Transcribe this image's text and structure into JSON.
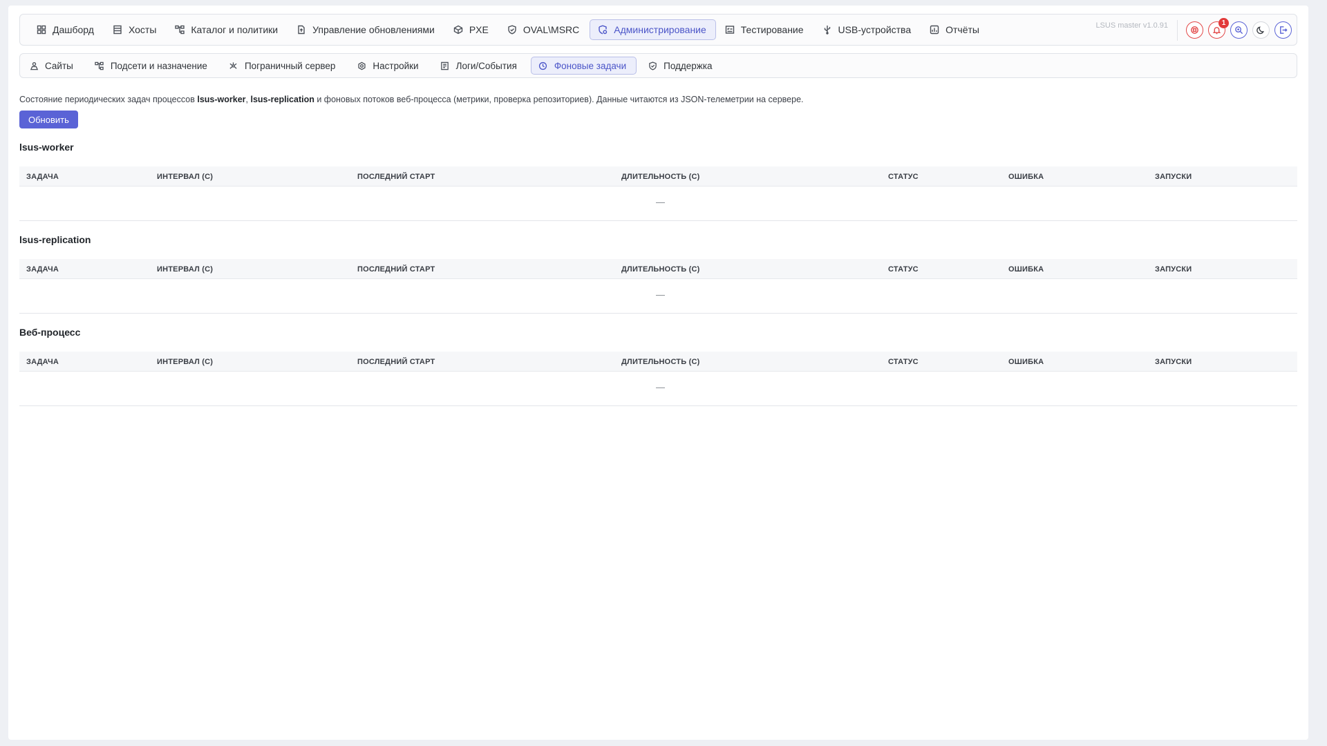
{
  "nav": {
    "items": [
      {
        "label": "Дашборд",
        "icon": "dashboard-icon"
      },
      {
        "label": "Хосты",
        "icon": "server-icon"
      },
      {
        "label": "Каталог и политики",
        "icon": "hierarchy-icon"
      },
      {
        "label": "Управление обновлениями",
        "icon": "file-upload-icon"
      },
      {
        "label": "PXE",
        "icon": "cube-icon"
      },
      {
        "label": "OVAL\\MSRC",
        "icon": "shield-check-icon"
      },
      {
        "label": "Администрирование",
        "icon": "admin-settings-icon",
        "active": true
      },
      {
        "label": "Тестирование",
        "icon": "checklist-icon"
      },
      {
        "label": "USB-устройства",
        "icon": "usb-icon"
      },
      {
        "label": "Отчёты",
        "icon": "report-icon"
      }
    ],
    "version": "LSUS master v1.0.91",
    "notification_count": "1"
  },
  "subnav": {
    "items": [
      {
        "label": "Сайты",
        "icon": "sites-icon"
      },
      {
        "label": "Подсети и назначение",
        "icon": "subnet-icon"
      },
      {
        "label": "Пограничный сервер",
        "icon": "network-hub-icon"
      },
      {
        "label": "Настройки",
        "icon": "gear-icon"
      },
      {
        "label": "Логи/События",
        "icon": "log-icon"
      },
      {
        "label": "Фоновые задачи",
        "icon": "clock-icon",
        "active": true
      },
      {
        "label": "Поддержка",
        "icon": "shield-icon"
      }
    ]
  },
  "description": {
    "prefix": "Состояние периодических задач процессов ",
    "worker": "lsus-worker",
    "comma": ", ",
    "replication": "lsus-replication",
    "suffix": " и фоновых потоков веб-процесса (метрики, проверка репозиториев). Данные читаются из JSON-телеметрии на сервере."
  },
  "refresh_label": "Обновить",
  "columns": [
    "ЗАДАЧА",
    "ИНТЕРВАЛ (С)",
    "ПОСЛЕДНИЙ СТАРТ",
    "ДЛИТЕЛЬНОСТЬ (С)",
    "СТАТУС",
    "ОШИБКА",
    "ЗАПУСКИ"
  ],
  "sections": [
    {
      "title": "lsus-worker",
      "empty": "—"
    },
    {
      "title": "lsus-replication",
      "empty": "—"
    },
    {
      "title": "Веб-процесс",
      "empty": "—"
    }
  ],
  "colors": {
    "accent": "#5a63d6",
    "danger": "#e24848"
  }
}
